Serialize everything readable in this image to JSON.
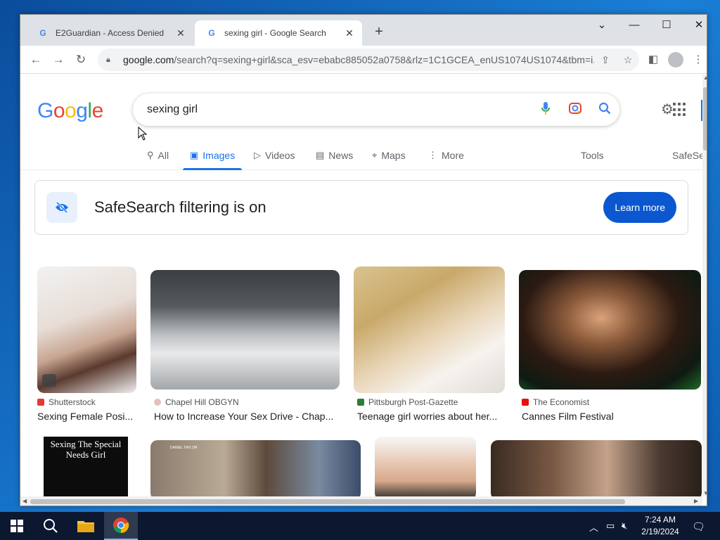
{
  "browser": {
    "tabs": [
      {
        "title": "E2Guardian - Access Denied",
        "active": false
      },
      {
        "title": "sexing girl - Google Search",
        "active": true
      }
    ],
    "url_host": "google.com",
    "url_rest": "/search?q=sexing+girl&sca_esv=ebabc885052a0758&rlz=1C1GCEA_enUS1074US1074&tbm=i..."
  },
  "google": {
    "logo_letters": [
      "G",
      "o",
      "o",
      "g",
      "l",
      "e"
    ],
    "logo_colors": [
      "#4285f4",
      "#ea4335",
      "#fbbc05",
      "#4285f4",
      "#34a853",
      "#ea4335"
    ],
    "query": "sexing girl",
    "nav_tabs": [
      "All",
      "Images",
      "Videos",
      "News",
      "Maps",
      "More"
    ],
    "tools_label": "Tools",
    "safesearch_label": "SafeSe",
    "banner_text": "SafeSearch filtering is on",
    "learn_more": "Learn more"
  },
  "results": [
    {
      "source": "Shutterstock",
      "caption": "Sexing Female Posi...",
      "fav_color": "#e53935"
    },
    {
      "source": "Chapel Hill OBGYN",
      "caption": "How to Increase Your Sex Drive - Chap...",
      "fav_color": "#e0c0c0"
    },
    {
      "source": "Pittsburgh Post-Gazette",
      "caption": "Teenage girl worries about her...",
      "fav_color": "#2e7d32"
    },
    {
      "source": "The Economist",
      "caption": "Cannes Film Festival",
      "fav_color": "#e3120b"
    }
  ],
  "row2": {
    "book_title": "Sexing The Special Needs Girl",
    "tiny_name": "DANIEL TAYLOR"
  },
  "taskbar": {
    "time": "7:24 AM",
    "date": "2/19/2024"
  }
}
